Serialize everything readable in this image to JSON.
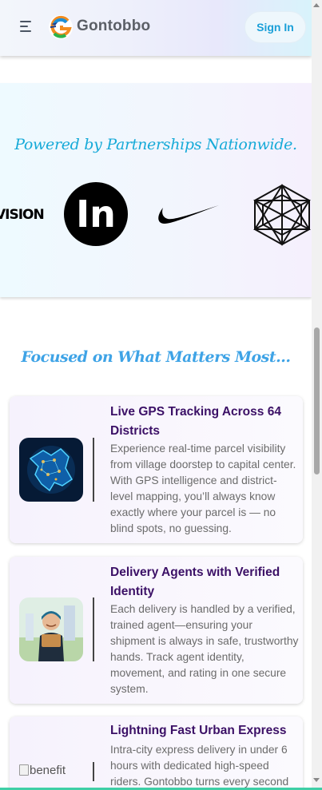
{
  "header": {
    "brand": "Gontobbo",
    "sign_in": "Sign In",
    "menu_icon": "hamburger-menu-icon",
    "logo_icon": "gontobbo-logo-icon"
  },
  "partners": {
    "title": "Powered by Partnerships Nationwide.",
    "logos": [
      {
        "name": "vision-logo",
        "text": "VISION"
      },
      {
        "name": "linkedin-logo",
        "text": "In"
      },
      {
        "name": "nike-logo",
        "text": ""
      },
      {
        "name": "geometric-hexagon-logo",
        "text": ""
      }
    ]
  },
  "focus": {
    "title": "Focused on What Matters Most...",
    "cards": [
      {
        "title": "Live GPS Tracking Across 64 Districts",
        "description": "Experience real-time parcel visibility from village doorstep to capital center. With GPS intelligence and district-level mapping, you’ll always know exactly where your parcel is — no blind spots, no guessing.",
        "image": "bangladesh-gps-map-image"
      },
      {
        "title": "Delivery Agents with Verified Identity",
        "description": "Each delivery is handled by a verified, trained agent—ensuring your shipment is always in safe, trustworthy hands. Track agent identity, movement, and rating in one secure system.",
        "image": "delivery-agent-image"
      },
      {
        "title": "Lightning Fast Urban Express",
        "description": "Intra-city express delivery in under 6 hours with dedicated high-speed riders. Gontobbo turns every second",
        "image_alt": "benefit"
      }
    ]
  },
  "colors": {
    "brand_blue": "#1a9fd8",
    "card_title": "#3b1066",
    "partners_title": "#16aad8",
    "focus_title": "#3ea3e6",
    "bottom_accent": "#3fcfa6"
  }
}
